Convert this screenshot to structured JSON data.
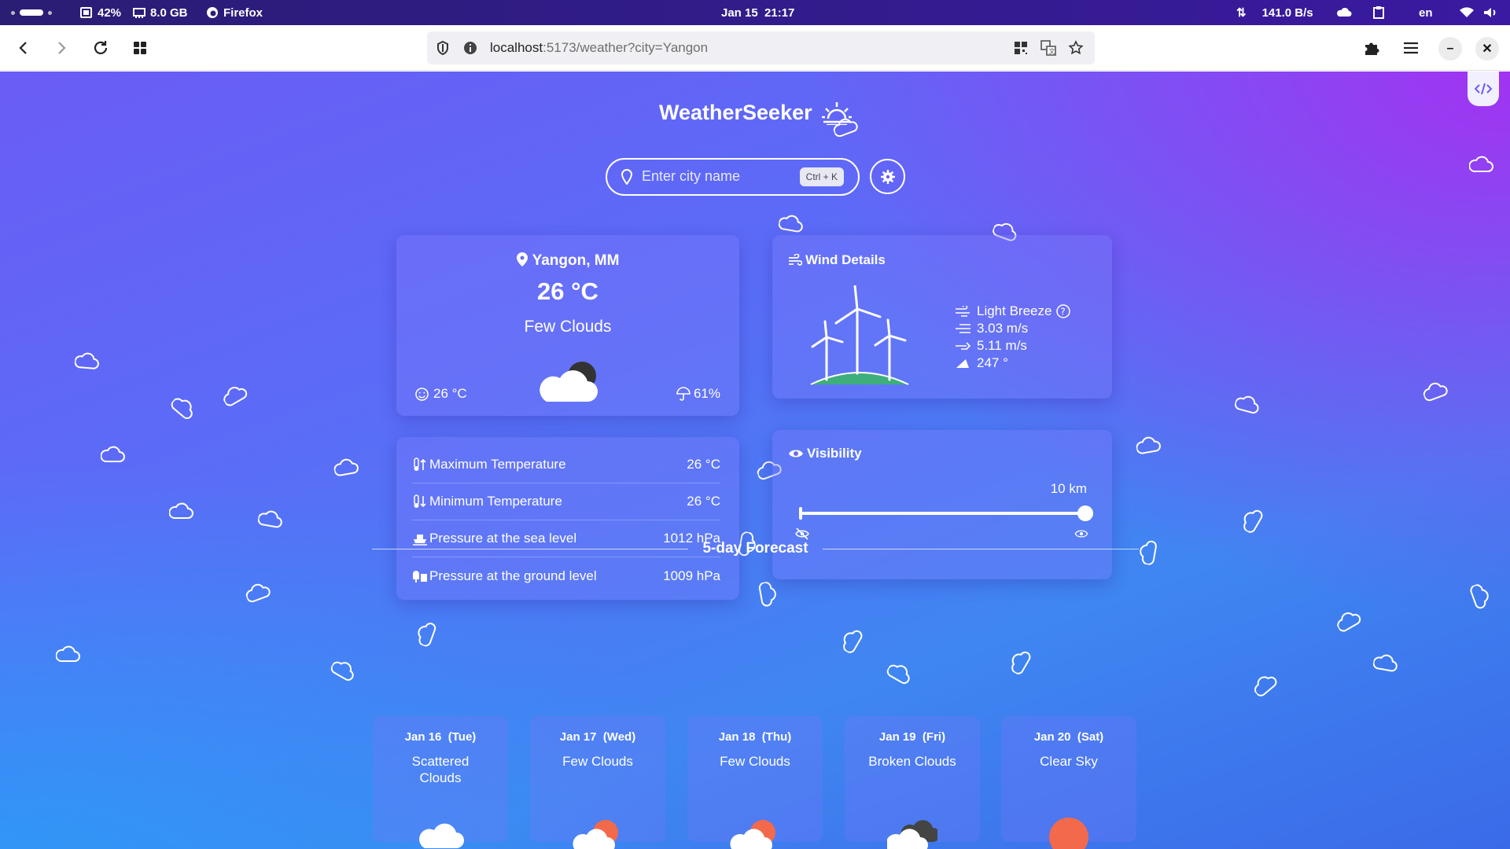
{
  "os": {
    "battery": "42%",
    "memory": "8.0 GB",
    "app": "Firefox",
    "datetime": "Jan 15  21:17",
    "network": "141.0 B/s",
    "lang": "en"
  },
  "browser": {
    "url_host": "localhost",
    "url_rest": ":5173/weather?city=Yangon"
  },
  "app": {
    "title": "WeatherSeeker",
    "search_placeholder": "Enter city name",
    "shortcut": "Ctrl + K"
  },
  "current": {
    "location": "Yangon, MM",
    "temp": "26 °C",
    "condition": "Few Clouds",
    "feels_like": "26 °C",
    "humidity": "61%"
  },
  "details": [
    {
      "label": "Maximum Temperature",
      "value": "26 °C"
    },
    {
      "label": "Minimum Temperature",
      "value": "26 °C"
    },
    {
      "label": "Pressure at the sea level",
      "value": "1012 hPa"
    },
    {
      "label": "Pressure at the ground level",
      "value": "1009 hPa"
    }
  ],
  "wind": {
    "title": "Wind Details",
    "description": "Light Breeze",
    "speed": "3.03 m/s",
    "gust": "5.11 m/s",
    "direction": "247 °"
  },
  "visibility": {
    "title": "Visibility",
    "value": "10 km",
    "level": 1.0
  },
  "forecast": {
    "title": "5-day Forecast",
    "days": [
      {
        "date": "Jan 16  (Tue)",
        "condition": "Scattered Clouds",
        "icon": "cloud-icon"
      },
      {
        "date": "Jan 17  (Wed)",
        "condition": "Few Clouds",
        "icon": "sun-cloud-icon"
      },
      {
        "date": "Jan 18  (Thu)",
        "condition": "Few Clouds",
        "icon": "sun-cloud-icon"
      },
      {
        "date": "Jan 19  (Fri)",
        "condition": "Broken Clouds",
        "icon": "dark-cloud-icon"
      },
      {
        "date": "Jan 20  (Sat)",
        "condition": "Clear Sky",
        "icon": "sun-icon"
      }
    ]
  },
  "colors": {
    "accent_sun": "#f26a4b",
    "grass": "#3fae7c",
    "page_purple": "#6a5cf6",
    "page_blue": "#3f86f2"
  }
}
